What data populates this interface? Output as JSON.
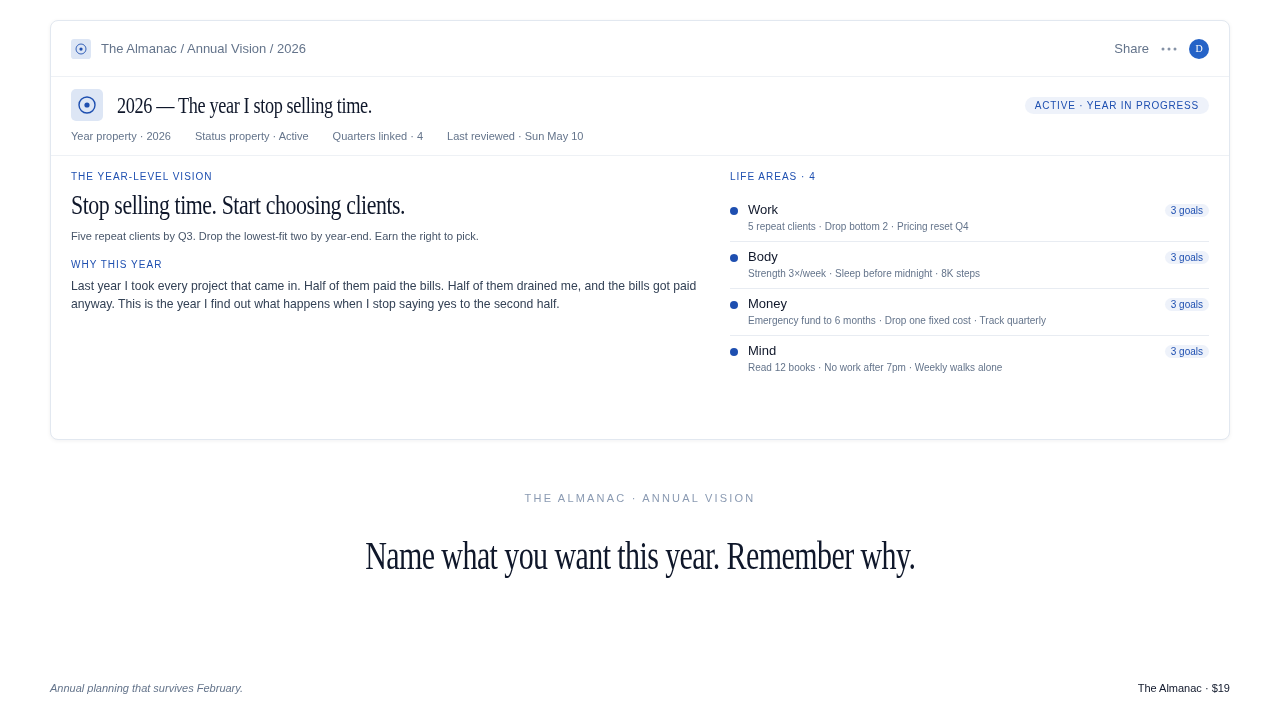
{
  "header": {
    "breadcrumb": "The Almanac / Annual Vision / 2026",
    "share": "Share",
    "avatar": "D"
  },
  "title_block": {
    "title": "2026 — The year I stop selling time.",
    "status_badge": "ACTIVE · YEAR IN PROGRESS",
    "properties": [
      "Year property · 2026",
      "Status property · Active",
      "Quarters linked · 4",
      "Last reviewed · Sun May 10"
    ]
  },
  "vision": {
    "label": "THE YEAR-LEVEL VISION",
    "headline": "Stop selling time. Start choosing clients.",
    "summary": "Five repeat clients by Q3. Drop the lowest-fit two by year-end. Earn the right to pick.",
    "why_label": "WHY THIS YEAR",
    "why_text": "Last year I took every project that came in. Half of them paid the bills. Half of them drained me, and the bills got paid anyway. This is the year I find out what happens when I stop saying yes to the second half."
  },
  "life_areas": {
    "label": "LIFE AREAS · 4",
    "items": [
      {
        "name": "Work",
        "details": "5 repeat clients · Drop bottom 2 · Pricing reset Q4",
        "goals": "3 goals"
      },
      {
        "name": "Body",
        "details": "Strength 3×/week · Sleep before midnight · 8K steps",
        "goals": "3 goals"
      },
      {
        "name": "Money",
        "details": "Emergency fund to 6 months · Drop one fixed cost · Track quarterly",
        "goals": "3 goals"
      },
      {
        "name": "Mind",
        "details": "Read 12 books · No work after 7pm · Weekly walks alone",
        "goals": "3 goals"
      }
    ]
  },
  "promo": {
    "eyebrow": "THE ALMANAC · ANNUAL VISION",
    "tagline": "Name what you want this year. Remember why."
  },
  "footer": {
    "note": "Annual planning that survives February.",
    "product": "The Almanac · $19"
  }
}
